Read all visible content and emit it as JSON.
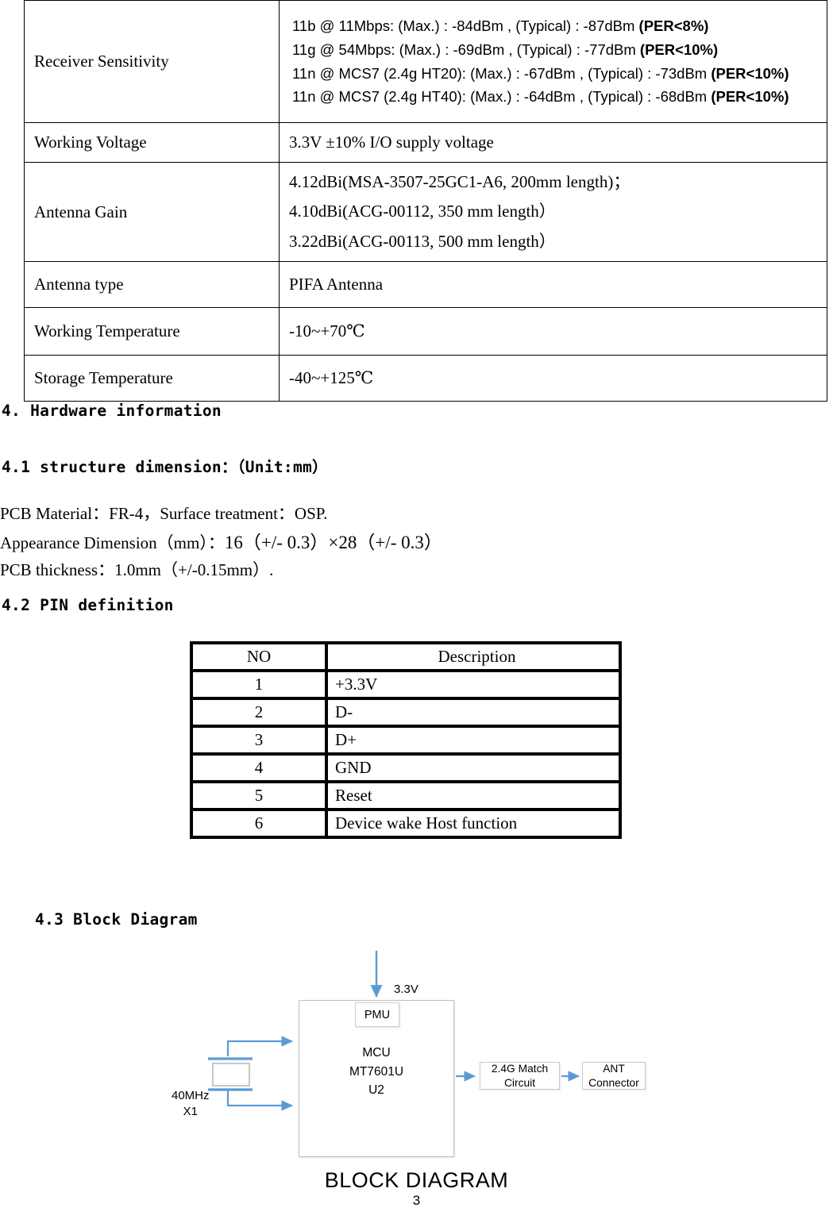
{
  "spec_table": {
    "rows": [
      {
        "label": "Receiver Sensitivity",
        "lines": [
          {
            "text": "11b @ 11Mbps: (Max.) : -84dBm , (Typical) : -87dBm ",
            "bold": "(PER<8%)"
          },
          {
            "text": "11g @ 54Mbps: (Max.) : -69dBm , (Typical) : -77dBm ",
            "bold": "(PER<10%)"
          },
          {
            "text": "11n @ MCS7 (2.4g HT20): (Max.) : -67dBm , (Typical) : -73dBm ",
            "bold": "(PER<10%)"
          },
          {
            "text": "11n @ MCS7 (2.4g HT40): (Max.) : -64dBm , (Typical) : -68dBm ",
            "bold": "(PER<10%)"
          }
        ]
      },
      {
        "label": "Working Voltage",
        "value": "3.3V ±10%    I/O supply voltage"
      },
      {
        "label": "Antenna Gain",
        "lines": [
          "4.12dBi(MSA-3507-25GC1-A6, 200mm length)；",
          "4.10dBi(ACG-00112, 350 mm length）",
          "3.22dBi(ACG-00113, 500 mm length）"
        ]
      },
      {
        "label": "Antenna type",
        "value": "PIFA Antenna"
      },
      {
        "label": "Working Temperature",
        "value": "-10~+70℃"
      },
      {
        "label": "Storage Temperature",
        "value": "-40~+125℃"
      }
    ]
  },
  "sections": {
    "h4": "4. Hardware information",
    "h41": "4.1 structure dimension：（Unit:mm）",
    "pcb_material": "PCB Material：FR-4，Surface treatment：OSP.",
    "appearance_prefix": "Appearance Dimension（mm）：",
    "appearance_value": "16（+/- 0.3）×28（+/- 0.3）",
    "pcb_thickness": "PCB thickness：1.0mm（+/-0.15mm）.",
    "h42": "4.2 PIN definition",
    "h43": "4.3 Block Diagram"
  },
  "pin_table": {
    "headers": {
      "no": "NO",
      "description": "Description"
    },
    "rows": [
      {
        "no": "1",
        "description": "+3.3V"
      },
      {
        "no": "2",
        "description": "D-"
      },
      {
        "no": "3",
        "description": "D+"
      },
      {
        "no": "4",
        "description": "GND"
      },
      {
        "no": "5",
        "description": "Reset"
      },
      {
        "no": "6",
        "description": "Device wake Host function"
      }
    ]
  },
  "block_diagram": {
    "title": "BLOCK DIAGRAM",
    "supply_label": "3.3V",
    "pmu": "PMU",
    "mcu_line1": "MCU",
    "mcu_line2": "MT7601U",
    "mcu_line3": "U2",
    "match_line1": "2.4G Match",
    "match_line2": "Circuit",
    "ant_line1": "ANT",
    "ant_line2": "Connector",
    "crystal_line1": "40MHz",
    "crystal_line2": "X1",
    "arrow_color": "#5B9BD5",
    "box_border_color": "#BFBFBF"
  },
  "page": {
    "number": "3"
  }
}
